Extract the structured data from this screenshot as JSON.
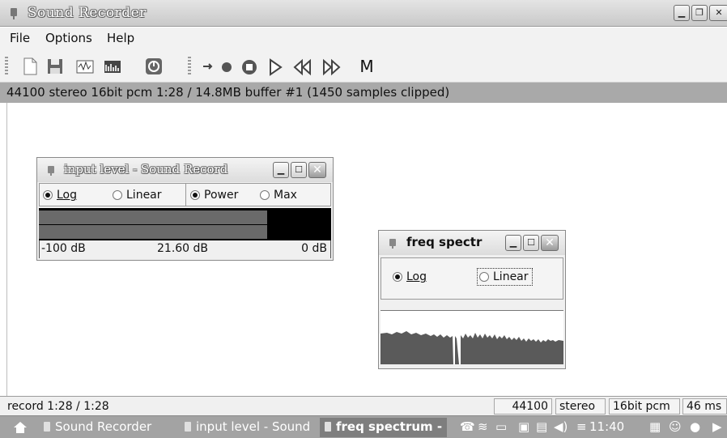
{
  "window": {
    "title": "Sound Recorder"
  },
  "menu": {
    "file": "File",
    "options": "Options",
    "help": "Help"
  },
  "toolbar": {
    "items": [
      "new-icon",
      "save-icon",
      "waveform-icon",
      "spectrum-icon",
      "input-level-icon",
      "arrow-right-icon",
      "record-icon",
      "stop-icon",
      "play-icon",
      "rewind-icon",
      "fast-forward-icon"
    ],
    "marker_label": "M"
  },
  "info": {
    "text": "44100 stereo 16bit pcm  1:28 / 14.8MB   buffer #1 (1450 samples clipped)"
  },
  "input_level": {
    "title": "input level - Sound Record",
    "radio_log": "Log",
    "radio_linear": "Linear",
    "radio_power": "Power",
    "radio_max": "Max",
    "selected_scale": "Log",
    "selected_mode": "Power",
    "scale_min": "-100 dB",
    "scale_value": "21.60 dB",
    "scale_max": "0 dB",
    "level_fraction": 0.78
  },
  "freq_spectrum": {
    "title": "freq spectr",
    "radio_log": "Log",
    "radio_linear": "Linear",
    "selected_scale": "Log"
  },
  "status": {
    "record": "record 1:28 / 1:28",
    "rate": "44100",
    "channels": "stereo",
    "format": "16bit pcm",
    "latency": "46 ms"
  },
  "taskbar": {
    "tasks": [
      "Sound Recorder",
      "input level - Sound",
      "freq spectrum -"
    ],
    "clock": "11:40"
  },
  "colors": {
    "infobar": "#a9a9a9",
    "taskbar": "#a3a3a3",
    "meter_bg": "#000000",
    "meter_fill": "#6a6a6a",
    "spectrum": "#5a5a5a"
  }
}
